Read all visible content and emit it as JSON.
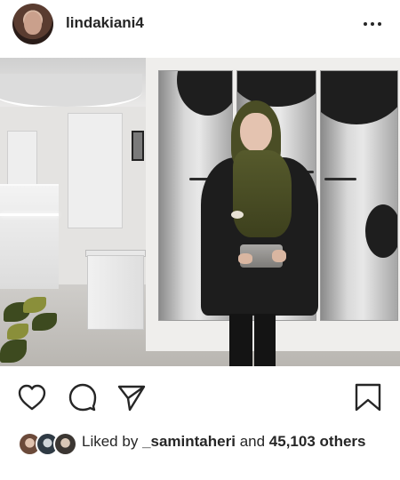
{
  "post": {
    "username": "lindakiani4",
    "icons": {
      "more": "more-horizontal-icon",
      "like": "heart-icon",
      "comment": "comment-icon",
      "share": "share-icon",
      "save": "bookmark-icon"
    }
  },
  "likes": {
    "prefix": "Liked by",
    "liker": "_samintaheri",
    "joiner": "and",
    "count": "45,103",
    "suffix": "others"
  },
  "colors": {
    "text": "#262626",
    "background": "#ffffff"
  }
}
